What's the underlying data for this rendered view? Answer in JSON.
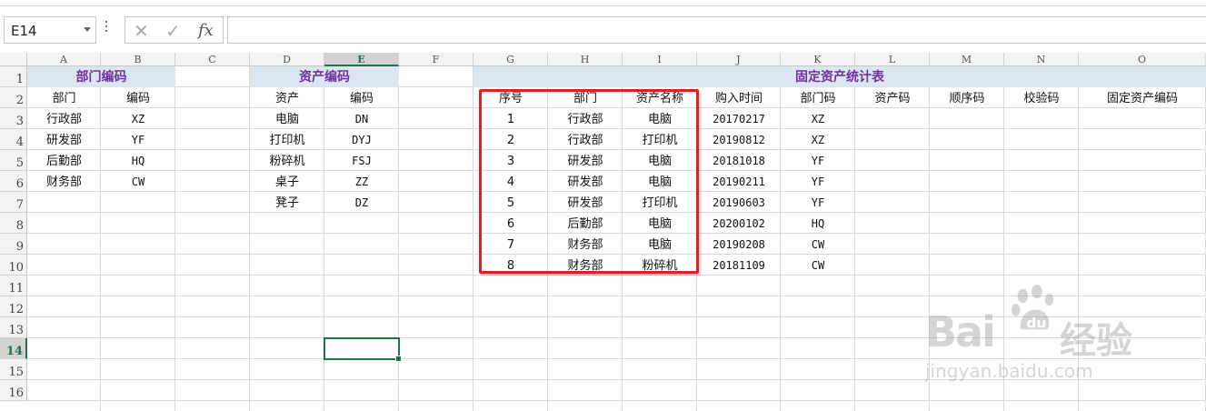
{
  "formula_bar": {
    "name_box": "E14",
    "cancel_glyph": "✕",
    "enter_glyph": "✓",
    "fx_label": "fx",
    "formula": ""
  },
  "columns": [
    "A",
    "B",
    "C",
    "D",
    "E",
    "F",
    "G",
    "H",
    "I",
    "J",
    "K",
    "L",
    "M",
    "N",
    "O"
  ],
  "selected_column": "E",
  "rows": [
    "1",
    "2",
    "3",
    "4",
    "5",
    "6",
    "7",
    "8",
    "9",
    "10",
    "11",
    "12",
    "13",
    "14",
    "15",
    "16"
  ],
  "selected_row": "14",
  "dept_table": {
    "title": "部门编码",
    "headers": [
      "部门",
      "编码"
    ],
    "rows": [
      [
        "行政部",
        "XZ"
      ],
      [
        "研发部",
        "YF"
      ],
      [
        "后勤部",
        "HQ"
      ],
      [
        "财务部",
        "CW"
      ]
    ]
  },
  "asset_table": {
    "title": "资产编码",
    "headers": [
      "资产",
      "编码"
    ],
    "rows": [
      [
        "电脑",
        "DN"
      ],
      [
        "打印机",
        "DYJ"
      ],
      [
        "粉碎机",
        "FSJ"
      ],
      [
        "桌子",
        "ZZ"
      ],
      [
        "凳子",
        "DZ"
      ]
    ]
  },
  "stats_table": {
    "title": "固定资产统计表",
    "headers": [
      "序号",
      "部门",
      "资产名称",
      "购入时间",
      "部门码",
      "资产码",
      "顺序码",
      "校验码",
      "固定资产编码"
    ],
    "rows": [
      [
        "1",
        "行政部",
        "电脑",
        "20170217",
        "XZ",
        "",
        "",
        "",
        ""
      ],
      [
        "2",
        "行政部",
        "打印机",
        "20190812",
        "XZ",
        "",
        "",
        "",
        ""
      ],
      [
        "3",
        "研发部",
        "电脑",
        "20181018",
        "YF",
        "",
        "",
        "",
        ""
      ],
      [
        "4",
        "研发部",
        "电脑",
        "20190211",
        "YF",
        "",
        "",
        "",
        ""
      ],
      [
        "5",
        "研发部",
        "打印机",
        "20190603",
        "YF",
        "",
        "",
        "",
        ""
      ],
      [
        "6",
        "后勤部",
        "电脑",
        "20200102",
        "HQ",
        "",
        "",
        "",
        ""
      ],
      [
        "7",
        "财务部",
        "电脑",
        "20190208",
        "CW",
        "",
        "",
        "",
        ""
      ],
      [
        "8",
        "财务部",
        "粉碎机",
        "20181109",
        "CW",
        "",
        "",
        "",
        ""
      ]
    ]
  },
  "watermark": {
    "brand_left": "Bai",
    "brand_right": "经验",
    "url": "jingyan.baidu.com"
  },
  "colors": {
    "title_fill": "#dce6f1",
    "title_text": "#7030a0",
    "highlight_border": "#e02020",
    "selection": "#217346"
  }
}
